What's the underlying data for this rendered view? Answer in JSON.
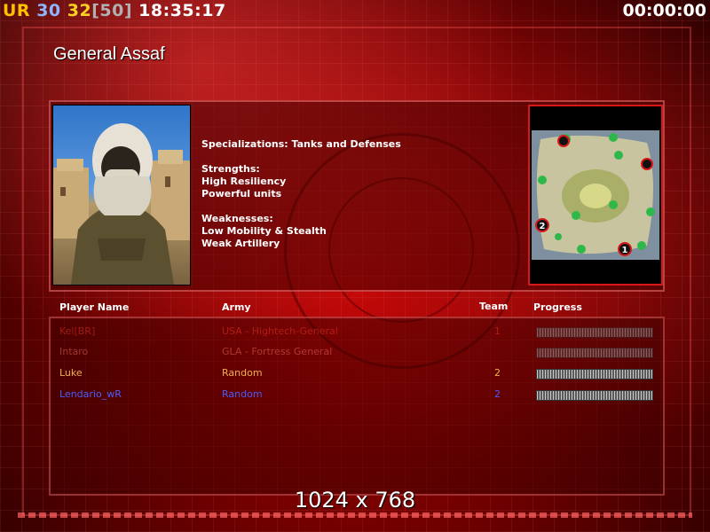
{
  "hud": {
    "ur": "UR",
    "count_a": "30",
    "count_b": "32",
    "count_max": "[50]",
    "clock": "18:35:17",
    "elapsed": "00:00:00"
  },
  "general": {
    "name": "General Assaf",
    "specializations": "Specializations: Tanks and Defenses",
    "strengths_title": "Strengths:",
    "strengths": [
      "High Resiliency",
      "Powerful units"
    ],
    "weaknesses_title": "Weaknesses:",
    "weaknesses": [
      "Low Mobility & Stealth",
      "Weak Artillery"
    ]
  },
  "minimap": {
    "start_positions": [
      "1",
      "2"
    ]
  },
  "players": {
    "headers": {
      "name": "Player Name",
      "army": "Army",
      "team": "Team",
      "progress": "Progress"
    },
    "rows": [
      {
        "name": "Kel[BR]",
        "army": "USA - Hightech-General",
        "team": "1",
        "progress": 1.0
      },
      {
        "name": "Intaro",
        "army": "GLA - Fortress General",
        "team": "",
        "progress": 1.0
      },
      {
        "name": "Luke",
        "army": "Random",
        "team": "2",
        "progress": 1.0
      },
      {
        "name": "Lendario_wR",
        "army": "Random",
        "team": "2",
        "progress": 1.0
      }
    ]
  },
  "resolution": "1024 x 768",
  "colors": {
    "accent": "#d81818",
    "player_1": "#ff3a2a",
    "player_3": "#f0b050",
    "player_4": "#4a5cff"
  }
}
